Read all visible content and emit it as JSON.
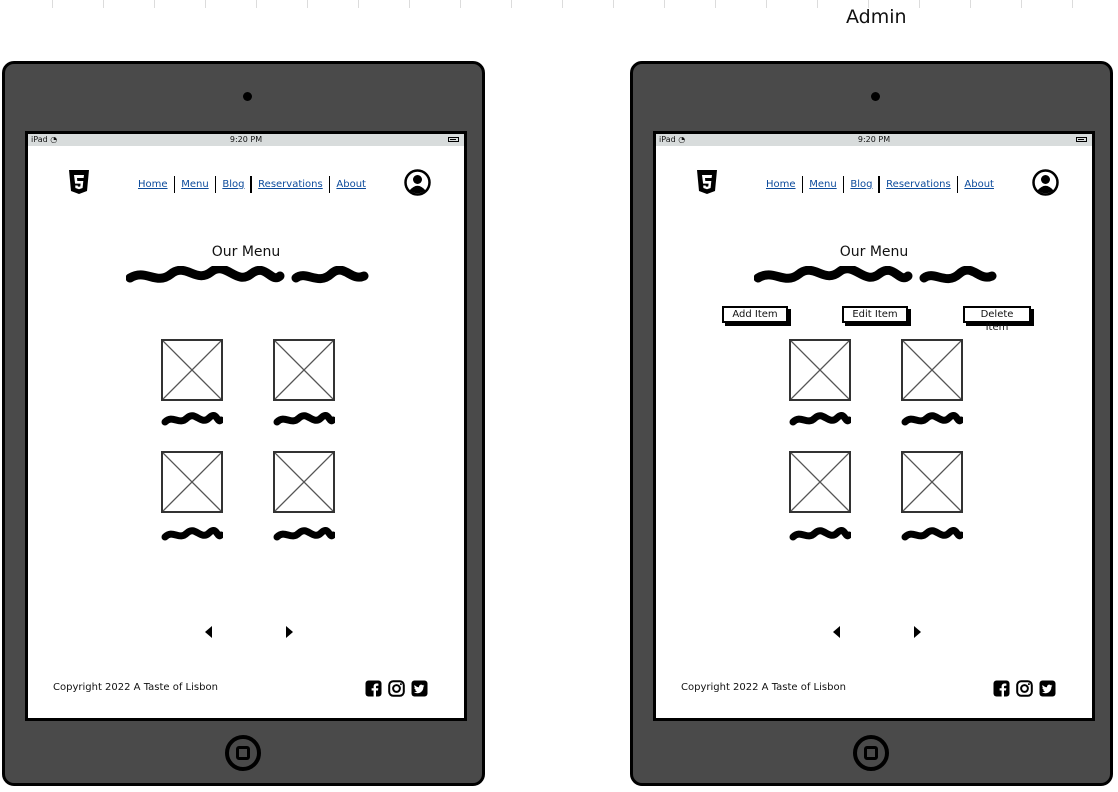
{
  "caption": "Admin",
  "devices": [
    {
      "id": "public",
      "status_bar": {
        "device": "iPad",
        "time": "9:20 PM"
      },
      "nav": {
        "items": [
          "Home",
          "Menu",
          "Blog",
          "Reservations",
          "About"
        ]
      },
      "heading": "Our Menu",
      "footer": {
        "copyright": "Copyright 2022 A Taste of Lisbon",
        "social": [
          "facebook-icon",
          "instagram-icon",
          "twitter-icon"
        ]
      }
    },
    {
      "id": "admin",
      "status_bar": {
        "device": "iPad",
        "time": "9:20 PM"
      },
      "nav": {
        "items": [
          "Home",
          "Menu",
          "Blog",
          "Reservations",
          "About"
        ]
      },
      "heading": "Our Menu",
      "admin_actions": [
        "Add Item",
        "Edit Item",
        "Delete Item"
      ],
      "footer": {
        "copyright": "Copyright 2022 A Taste of Lisbon",
        "social": [
          "facebook-icon",
          "instagram-icon",
          "twitter-icon"
        ]
      }
    }
  ]
}
